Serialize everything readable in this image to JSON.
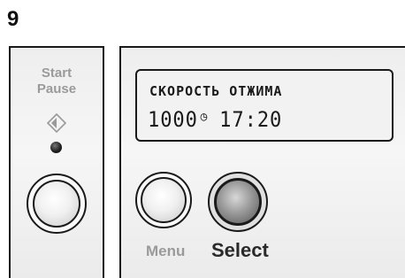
{
  "step_number": "9",
  "start_pause": {
    "label_line1": "Start",
    "label_line2": "Pause",
    "icon": "start-pause-icon"
  },
  "display": {
    "line1": "СКОРОСТЬ ОТЖИМА",
    "spin_speed": "1000",
    "spin_icon": "spin-icon",
    "time": "17:20"
  },
  "buttons": {
    "menu_label": "Menu",
    "select_label": "Select"
  },
  "colors": {
    "panel_border": "#1a1a1a",
    "label_gray": "#9a9a9a",
    "select_label": "#2a2a2a"
  }
}
